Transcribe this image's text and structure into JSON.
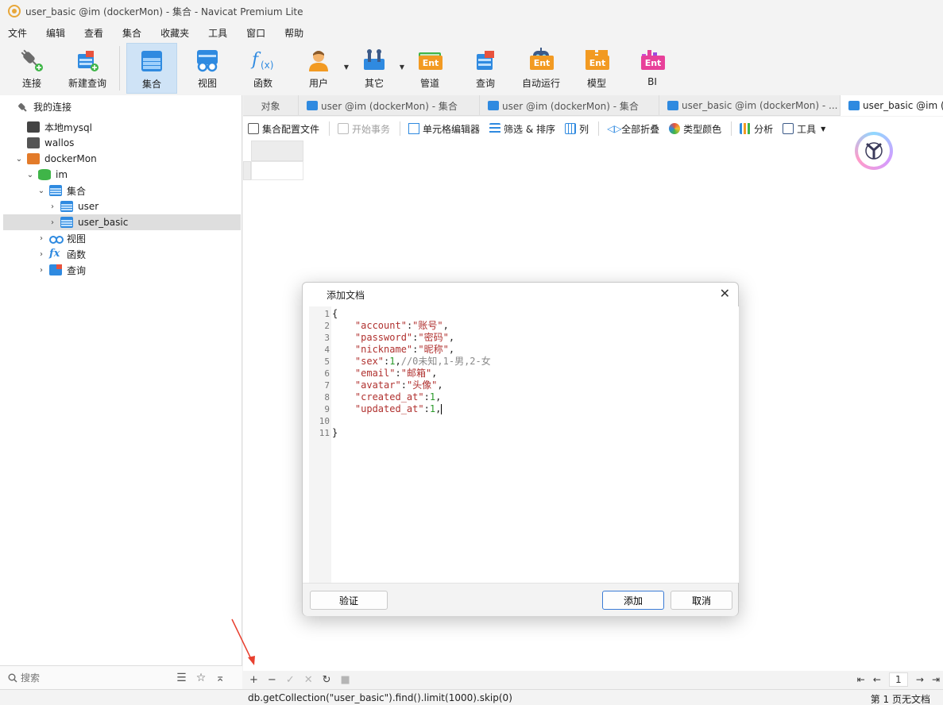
{
  "window": {
    "title": "user_basic @im (dockerMon) - 集合 - Navicat Premium Lite"
  },
  "menu": [
    "文件",
    "编辑",
    "查看",
    "集合",
    "收藏夹",
    "工具",
    "窗口",
    "帮助"
  ],
  "toolbar": {
    "connect": "连接",
    "new_query": "新建查询",
    "collection": "集合",
    "view": "视图",
    "function": "函数",
    "user": "用户",
    "other": "其它",
    "pipeline": "管道",
    "query": "查询",
    "automation": "自动运行",
    "model": "模型",
    "bi": "BI",
    "ent_badge": "Ent"
  },
  "sidebar": {
    "header": "我的连接",
    "items": [
      {
        "label": "本地mysql"
      },
      {
        "label": "wallos"
      },
      {
        "label": "dockerMon"
      },
      {
        "label": "im"
      },
      {
        "label": "集合"
      },
      {
        "label": "user"
      },
      {
        "label": "user_basic"
      },
      {
        "label": "视图"
      },
      {
        "label": "函数"
      },
      {
        "label": "查询"
      }
    ],
    "search_placeholder": "搜索"
  },
  "tabs": [
    {
      "label": "对象"
    },
    {
      "label": "user @im (dockerMon) - 集合"
    },
    {
      "label": "user @im (dockerMon) - 集合"
    },
    {
      "label": "user_basic @im (dockerMon) - ..."
    },
    {
      "label": "user_basic @im (d"
    }
  ],
  "subtoolbar": {
    "profile": "集合配置文件",
    "begin_tx": "开始事务",
    "cell_editor": "单元格编辑器",
    "filter_sort": "筛选 & 排序",
    "columns": "列",
    "collapse_all": "全部折叠",
    "type_color": "类型颜色",
    "analyze": "分析",
    "tools": "工具"
  },
  "dialog": {
    "title": "添加文档",
    "line_numbers": [
      "1",
      "2",
      "3",
      "4",
      "5",
      "6",
      "7",
      "8",
      "9",
      "10",
      "11"
    ],
    "code": {
      "l1": "{",
      "l2_key": "\"account\"",
      "l2_val": "\"账号\"",
      "l3_key": "\"password\"",
      "l3_val": "\"密码\"",
      "l4_key": "\"nickname\"",
      "l4_val": "\"昵称\"",
      "l5_key": "\"sex\"",
      "l5_val": "1",
      "l5_comment": "//0未知,1-男,2-女",
      "l6_key": "\"email\"",
      "l6_val": "\"邮箱\"",
      "l7_key": "\"avatar\"",
      "l7_val": "\"头像\"",
      "l8_key": "\"created_at\"",
      "l8_val": "1",
      "l9_key": "\"updated_at\"",
      "l9_val": "1",
      "l11": "}"
    },
    "validate": "验证",
    "add": "添加",
    "cancel": "取消"
  },
  "pager": {
    "page": "1"
  },
  "status": {
    "query": "db.getCollection(\"user_basic\").find().limit(1000).skip(0)",
    "page_info": "第 1 页无文档"
  }
}
